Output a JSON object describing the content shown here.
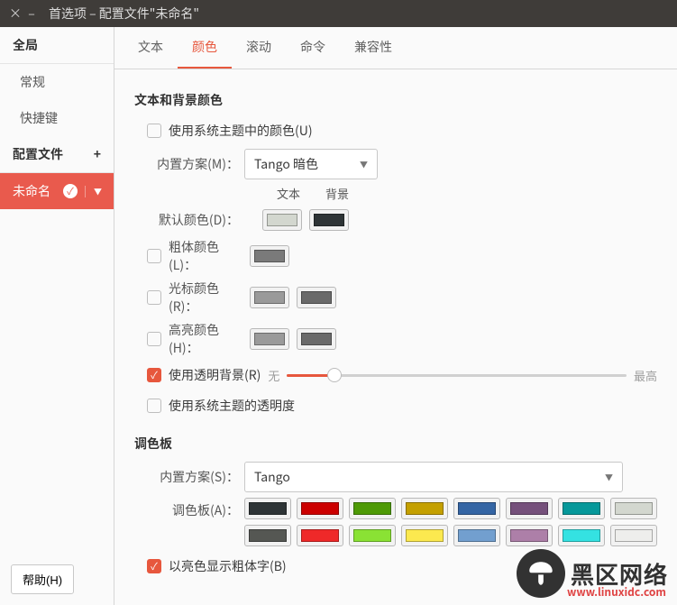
{
  "window": {
    "title": "首选项 – 配置文件\"未命名\""
  },
  "sidebar": {
    "global": "全局",
    "general": "常规",
    "shortcuts": "快捷键",
    "profiles": "配置文件",
    "active_profile": "未命名"
  },
  "tabs": [
    "文本",
    "颜色",
    "滚动",
    "命令",
    "兼容性"
  ],
  "section1": {
    "title": "文本和背景颜色",
    "use_theme": "使用系统主题中的颜色(U)",
    "builtin_label": "内置方案(M)：",
    "builtin_value": "Tango 暗色",
    "col_text": "文本",
    "col_bg": "背景",
    "default_label": "默认颜色(D)：",
    "bold_label": "粗体颜色(L)：",
    "cursor_label": "光标颜色(R)：",
    "highlight_label": "高亮颜色(H)：",
    "transparent_label": "使用透明背景(R)",
    "transparent_min": "无",
    "transparent_max": "最高",
    "sys_transparent": "使用系统主题的透明度",
    "colors": {
      "default_text": "#d3d7cf",
      "default_bg": "#2e3436",
      "bold": "#7a7a7a",
      "cursor_text": "#9a9a9a",
      "cursor_bg": "#6a6a6a",
      "highlight_text": "#9a9a9a",
      "highlight_bg": "#6a6a6a"
    }
  },
  "section2": {
    "title": "调色板",
    "builtin_label": "内置方案(S)：",
    "builtin_value": "Tango",
    "palette_label": "调色板(A)：",
    "bright_bold": "以亮色显示粗体字(B)",
    "palette": [
      "#2e3436",
      "#cc0000",
      "#4e9a06",
      "#c4a000",
      "#3465a4",
      "#75507b",
      "#06989a",
      "#d3d7cf",
      "#555753",
      "#ef2929",
      "#8ae234",
      "#fce94f",
      "#729fcf",
      "#ad7fa8",
      "#34e2e2",
      "#eeeeec"
    ]
  },
  "help": "帮助(H)",
  "watermark": {
    "text": "黑区网络",
    "url": "www.linuxidc.com"
  }
}
